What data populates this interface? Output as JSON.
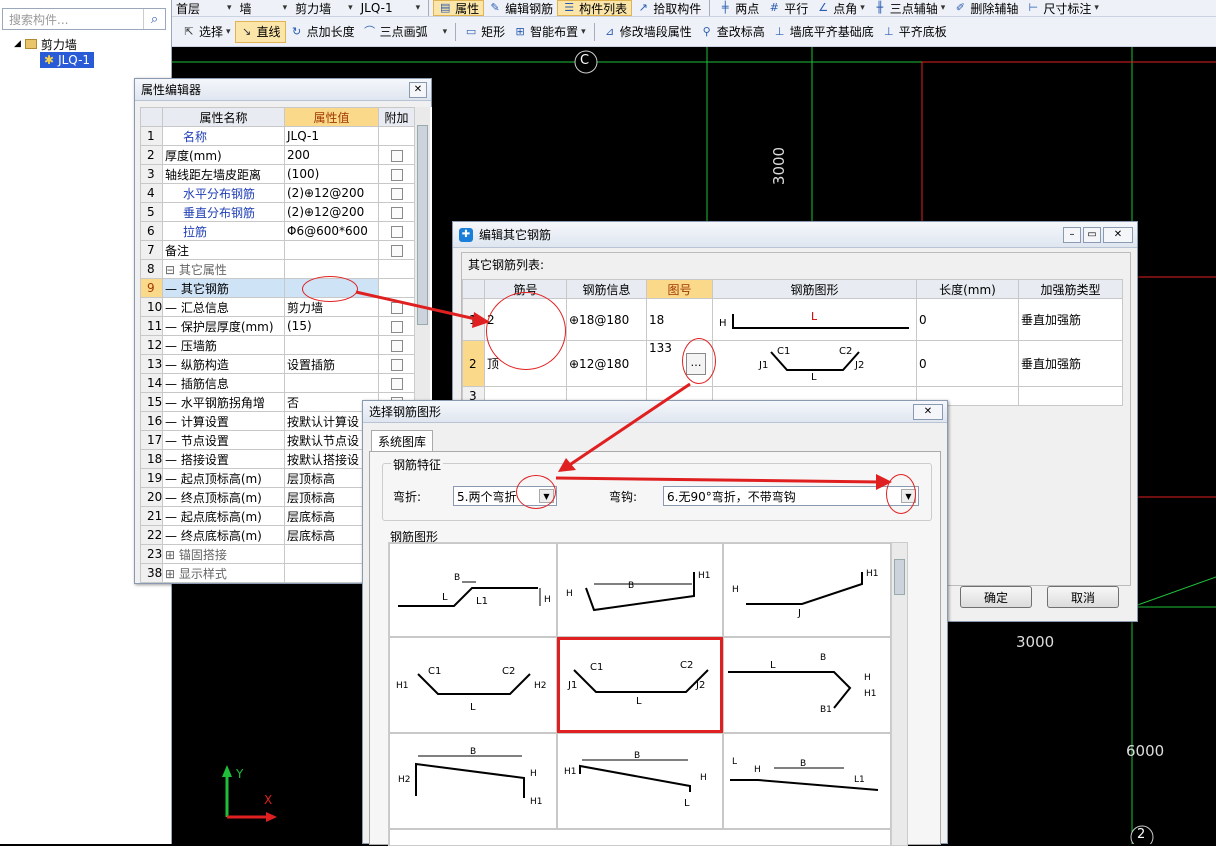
{
  "left": {
    "search_placeholder": "搜索构件...",
    "tree_root": "剪力墙",
    "tree_child": "JLQ-1"
  },
  "toolbar1": {
    "floor": "首层",
    "category": "墙",
    "type": "剪力墙",
    "component": "JLQ-1",
    "items": [
      "属性",
      "编辑钢筋",
      "构件列表",
      "拾取构件",
      "两点",
      "平行",
      "点角",
      "三点辅轴",
      "删除辅轴",
      "尺寸标注"
    ]
  },
  "toolbar2": {
    "items": [
      "选择",
      "直线",
      "点加长度",
      "三点画弧",
      "矩形",
      "智能布置",
      "修改墙段属性",
      "查改标高",
      "墙底平齐基础底",
      "平齐底板"
    ]
  },
  "canvas": {
    "axis_c": "C",
    "axis_2": "2",
    "dim_3000_v": "3000",
    "dim_3000_h": "3000",
    "dim_6000": "6000",
    "y_label": "Y",
    "x_label": "X"
  },
  "prop_editor": {
    "title": "属性编辑器",
    "col_name": "属性名称",
    "col_value": "属性值",
    "col_extra": "附加",
    "rows": [
      {
        "n": "1",
        "name": "名称",
        "value": "JLQ-1",
        "blue": true,
        "chk": false
      },
      {
        "n": "2",
        "name": "厚度(mm)",
        "value": "200",
        "blue": false,
        "chk": true
      },
      {
        "n": "3",
        "name": "轴线距左墙皮距离",
        "value": "(100)",
        "blue": false,
        "chk": true
      },
      {
        "n": "4",
        "name": "水平分布钢筋",
        "value": "(2)⊕12@200",
        "blue": true,
        "chk": true
      },
      {
        "n": "5",
        "name": "垂直分布钢筋",
        "value": "(2)⊕12@200",
        "blue": true,
        "chk": true
      },
      {
        "n": "6",
        "name": "拉筋",
        "value": "Φ6@600*600",
        "blue": true,
        "chk": true
      },
      {
        "n": "7",
        "name": "备注",
        "value": "",
        "blue": false,
        "chk": true
      },
      {
        "n": "8",
        "name": "⊟ 其它属性",
        "value": "",
        "blue": false,
        "chk": false
      },
      {
        "n": "9",
        "name": "— 其它钢筋",
        "value": "",
        "blue": false,
        "chk": false
      },
      {
        "n": "10",
        "name": "— 汇总信息",
        "value": "剪力墙",
        "blue": false,
        "chk": true
      },
      {
        "n": "11",
        "name": "— 保护层厚度(mm)",
        "value": "(15)",
        "blue": false,
        "chk": true
      },
      {
        "n": "12",
        "name": "— 压墙筋",
        "value": "",
        "blue": false,
        "chk": true
      },
      {
        "n": "13",
        "name": "— 纵筋构造",
        "value": "设置插筋",
        "blue": false,
        "chk": true
      },
      {
        "n": "14",
        "name": "— 插筋信息",
        "value": "",
        "blue": false,
        "chk": true
      },
      {
        "n": "15",
        "name": "— 水平钢筋拐角增",
        "value": "否",
        "blue": false,
        "chk": true
      },
      {
        "n": "16",
        "name": "— 计算设置",
        "value": "按默认计算设",
        "blue": false,
        "chk": false
      },
      {
        "n": "17",
        "name": "— 节点设置",
        "value": "按默认节点设",
        "blue": false,
        "chk": false
      },
      {
        "n": "18",
        "name": "— 搭接设置",
        "value": "按默认搭接设",
        "blue": false,
        "chk": false
      },
      {
        "n": "19",
        "name": "— 起点顶标高(m)",
        "value": "层顶标高",
        "blue": false,
        "chk": false
      },
      {
        "n": "20",
        "name": "— 终点顶标高(m)",
        "value": "层顶标高",
        "blue": false,
        "chk": false
      },
      {
        "n": "21",
        "name": "— 起点底标高(m)",
        "value": "层底标高",
        "blue": false,
        "chk": false
      },
      {
        "n": "22",
        "name": "— 终点底标高(m)",
        "value": "层底标高",
        "blue": false,
        "chk": false
      },
      {
        "n": "23",
        "name": "⊞ 锚固搭接",
        "value": "",
        "blue": false,
        "chk": false
      },
      {
        "n": "38",
        "name": "⊞ 显示样式",
        "value": "",
        "blue": false,
        "chk": false
      }
    ]
  },
  "rebar_editor": {
    "title": "编辑其它钢筋",
    "list_label": "其它钢筋列表:",
    "headers": [
      "筋号",
      "钢筋信息",
      "图号",
      "钢筋图形",
      "长度(mm)",
      "加强筋类型"
    ],
    "rows": [
      {
        "n": "1",
        "id": "2",
        "info": "⊕18@180",
        "fig": "18",
        "len": "0",
        "type": "垂直加强筋"
      },
      {
        "n": "2",
        "id": "顶",
        "info": "⊕12@180",
        "fig": "133",
        "len": "0",
        "type": "垂直加强筋"
      },
      {
        "n": "3",
        "id": "",
        "info": "",
        "fig": "",
        "len": "",
        "type": ""
      }
    ],
    "ok": "确定",
    "cancel": "取消"
  },
  "shape_dialog": {
    "title": "选择钢筋图形",
    "tab": "系统图库",
    "group_label": "钢筋特征",
    "bend_label": "弯折:",
    "bend_value": "5.两个弯折",
    "hook_label": "弯钩:",
    "hook_value": "6.无90°弯折，不带弯钩",
    "shapes_label": "钢筋图形"
  }
}
